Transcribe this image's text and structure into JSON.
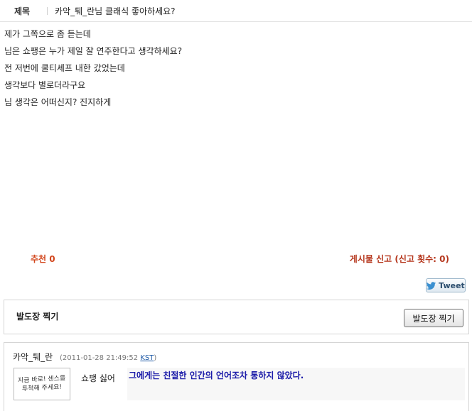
{
  "post": {
    "title_label": "제목",
    "title": "카악_퉤_란님 클래식 좋아하세요?",
    "body_lines": [
      "제가 그쪽으로 좀 듣는데",
      "님은 쇼팽은 누가 제일 잘 연주한다고 생각하세요?",
      "전 저번에 쿨티셰프 내한 갔었는데",
      "생각보다 별로더라구요",
      "님 생각은 어떠신지? 진지하게"
    ]
  },
  "actions": {
    "recommend": "추천 0",
    "report": "게시물 신고 (신고 횟수: 0)",
    "tweet": "Tweet"
  },
  "footprint": {
    "label": "발도장 찍기",
    "button": "발도장 찍기"
  },
  "comment": {
    "author": "카악_퉤_란",
    "time_open": "(",
    "timestamp": "2011-01-28 21:49:52",
    "tz": "KST",
    "time_close": ")",
    "avatar_lines": [
      "지금 바로! 센스를",
      "투척해 주세요!"
    ],
    "nickname": "쇼팽 싫어",
    "text": "그에게는 친절한 인간의 언어조차 통하지 않았다."
  }
}
